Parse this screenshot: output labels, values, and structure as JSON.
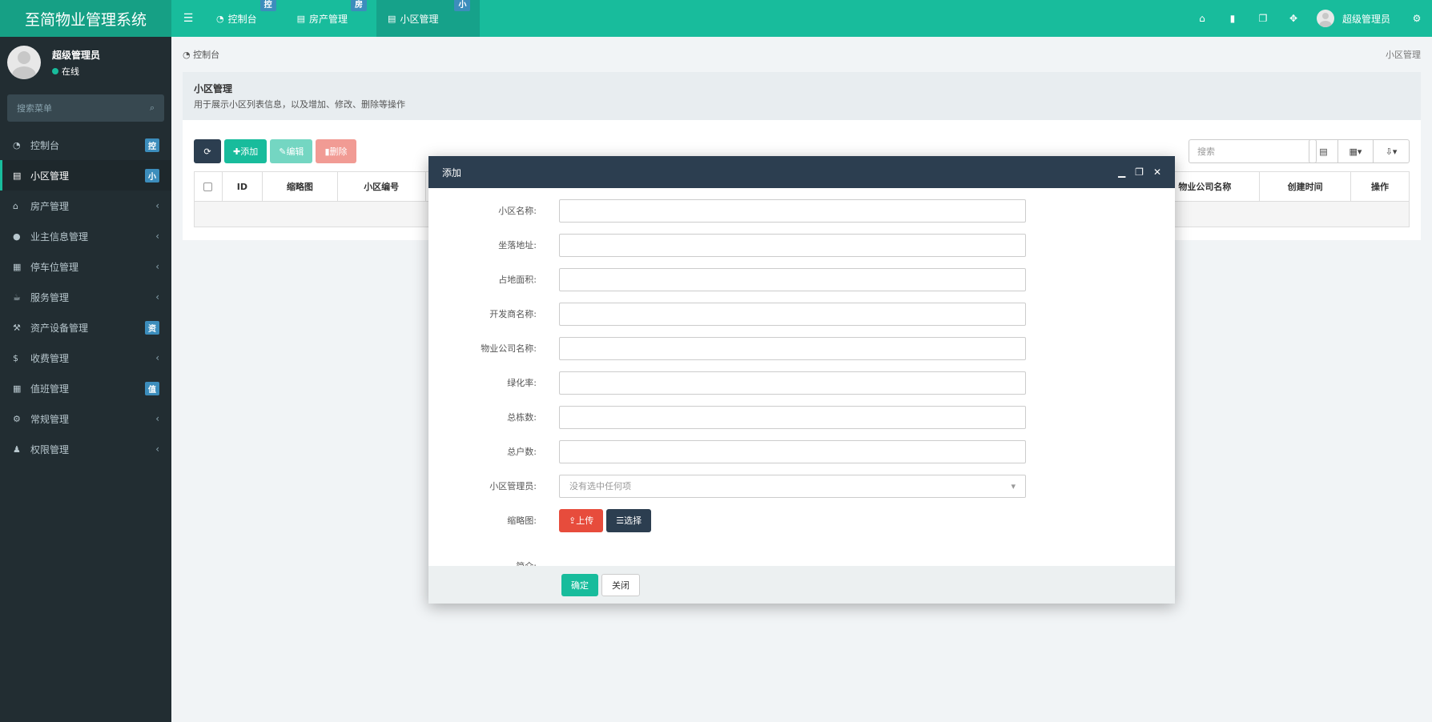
{
  "app": {
    "title": "至简物业管理系统"
  },
  "header": {
    "tabs": [
      {
        "label": "控制台",
        "badge": "控"
      },
      {
        "label": "房产管理",
        "badge": "房"
      },
      {
        "label": "小区管理",
        "badge": "小"
      }
    ],
    "user_name": "超级管理员"
  },
  "sidebar": {
    "user_name": "超级管理员",
    "status": "在线",
    "search_placeholder": "搜索菜单",
    "items": [
      {
        "label": "控制台",
        "badge": "控"
      },
      {
        "label": "小区管理",
        "badge": "小"
      },
      {
        "label": "房产管理",
        "chevron": "‹"
      },
      {
        "label": "业主信息管理",
        "chevron": "‹"
      },
      {
        "label": "停车位管理",
        "chevron": "‹"
      },
      {
        "label": "服务管理",
        "chevron": "‹"
      },
      {
        "label": "资产设备管理",
        "badge": "资"
      },
      {
        "label": "收费管理",
        "chevron": "‹"
      },
      {
        "label": "值班管理",
        "badge": "值"
      },
      {
        "label": "常规管理",
        "chevron": "‹"
      },
      {
        "label": "权限管理",
        "chevron": "‹"
      }
    ]
  },
  "breadcrumb": {
    "home": "控制台",
    "current": "小区管理"
  },
  "page": {
    "title": "小区管理",
    "description": "用于展示小区列表信息，以及增加、修改、删除等操作"
  },
  "toolbar": {
    "add": "添加",
    "edit": "编辑",
    "delete": "删除",
    "search_placeholder": "搜索"
  },
  "table": {
    "headers": [
      "ID",
      "缩略图",
      "小区编号",
      "物业公司名称",
      "创建时间",
      "操作"
    ]
  },
  "modal": {
    "title": "添加",
    "fields": [
      {
        "label": "小区名称:"
      },
      {
        "label": "坐落地址:"
      },
      {
        "label": "占地面积:"
      },
      {
        "label": "开发商名称:"
      },
      {
        "label": "物业公司名称:"
      },
      {
        "label": "绿化率:"
      },
      {
        "label": "总栋数:"
      },
      {
        "label": "总户数:"
      }
    ],
    "manager_label": "小区管理员:",
    "manager_placeholder": "没有选中任何项",
    "thumb_label": "缩略图:",
    "upload": "上传",
    "choose": "选择",
    "next_label": "简介:",
    "ok": "确定",
    "close": "关闭"
  }
}
